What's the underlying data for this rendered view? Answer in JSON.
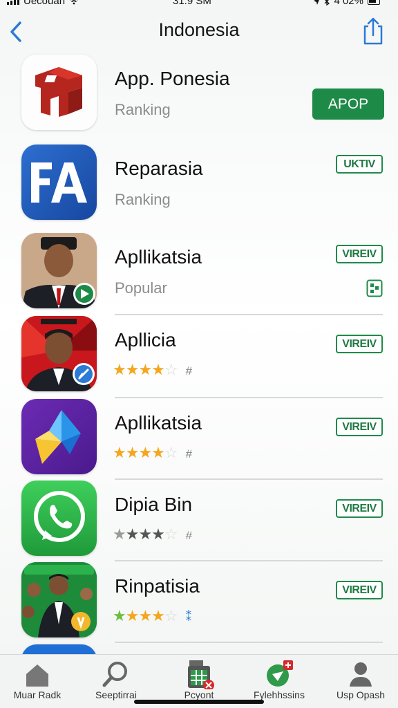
{
  "status_bar": {
    "carrier": "Uecouan",
    "time": "31:9 SM",
    "battery": "4 02%"
  },
  "nav": {
    "title": "Indonesia"
  },
  "apps": [
    {
      "name": "App. Ponesia",
      "subtitle": "Ranking",
      "button": "APOP",
      "button_style": "filled"
    },
    {
      "name": "Reparasia",
      "subtitle": "Ranking",
      "button": "UKTIV",
      "button_style": "outline"
    },
    {
      "name": "Apllikatsia",
      "subtitle": "Popular",
      "button": "VIREIV",
      "button_style": "outline"
    },
    {
      "name": "Apllicia",
      "rating": 4,
      "rating_max": 5,
      "rating_mark": "#",
      "button": "VIREIV",
      "button_style": "outline"
    },
    {
      "name": "Apllikatsia",
      "rating": 4,
      "rating_max": 5,
      "rating_mark": "#",
      "button": "VIREIV",
      "button_style": "outline"
    },
    {
      "name": "Dipia Bin",
      "rating": 4,
      "rating_max": 5,
      "rating_mark": "#",
      "button": "VIREIV",
      "button_style": "outline"
    },
    {
      "name": "Rinpatisia",
      "rating": 4,
      "rating_max": 5,
      "rating_mark": "⁑",
      "button": "VIREIV",
      "button_style": "outline"
    }
  ],
  "tabs": [
    {
      "label": "Muar Radk",
      "icon": "home-icon"
    },
    {
      "label": "Seeptirrai",
      "icon": "search-icon"
    },
    {
      "label": "Pcyont",
      "icon": "grid-icon"
    },
    {
      "label": "Fylehhssins",
      "icon": "map-pin-icon"
    },
    {
      "label": "Usp Opash",
      "icon": "person-icon"
    }
  ],
  "colors": {
    "accent_green": "#1e8a47",
    "accent_blue": "#2a7ad6",
    "star_gold": "#f4a61d"
  }
}
